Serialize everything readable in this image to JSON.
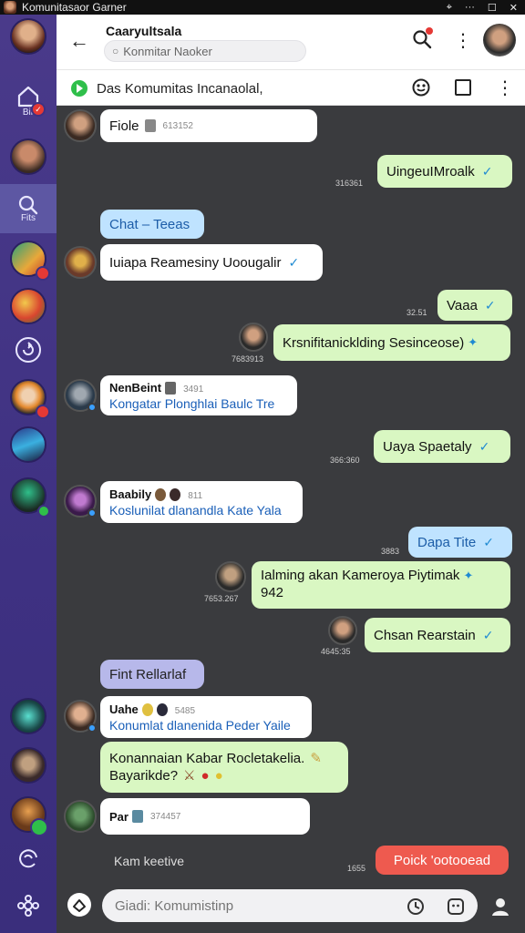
{
  "window": {
    "title": "Komunitasaor Garner",
    "controls": [
      "⌖",
      "···",
      "☐",
      "✕"
    ]
  },
  "rail": {
    "items": [
      {
        "type": "avatar",
        "name": "profile",
        "color": "#c98160"
      },
      {
        "type": "icon",
        "icon": "home-icon",
        "label": "Bir",
        "badge": "red"
      },
      {
        "type": "avatar",
        "name": "friend-1",
        "color": "#9a6a4a"
      },
      {
        "type": "icon",
        "icon": "search-icon",
        "label": "Fits",
        "active": true
      },
      {
        "type": "avatar",
        "name": "game-1",
        "color": "#2f9a8a",
        "badge": "red"
      },
      {
        "type": "avatar",
        "name": "game-2",
        "color": "#d9462f"
      },
      {
        "type": "icon",
        "icon": "refresh-icon",
        "label": ""
      },
      {
        "type": "avatar",
        "name": "game-3",
        "color": "#e58a2f",
        "badge": "red"
      },
      {
        "type": "avatar",
        "name": "game-4",
        "color": "#3a8ac9"
      },
      {
        "type": "avatar",
        "name": "game-5",
        "color": "#1f7a5a",
        "badge": "green"
      },
      {
        "type": "avatar",
        "name": "game-6",
        "color": "#2a9aa0"
      },
      {
        "type": "avatar",
        "name": "game-7",
        "color": "#5a4a3a"
      },
      {
        "type": "avatar",
        "name": "game-8",
        "color": "#8a5a2a",
        "badge": "green"
      },
      {
        "type": "icon",
        "icon": "mention-icon",
        "label": ""
      },
      {
        "type": "icon",
        "icon": "settings-icon",
        "label": ""
      }
    ]
  },
  "header": {
    "title": "Caaryultsala",
    "search_placeholder": "Konmitar Naoker",
    "search_icon": "search-icon",
    "menu_icon": "kebab-icon"
  },
  "community": {
    "title": "Das Komumitas Incanaolal,",
    "icons": [
      "emoji-icon",
      "square-icon",
      "kebab-icon"
    ]
  },
  "messages": [
    {
      "dir": "in",
      "avatar": true,
      "text": "Fiole",
      "meta": "613152"
    },
    {
      "dir": "out",
      "text": "UingeuIMroalk",
      "ts": "316361",
      "tick": true
    },
    {
      "dir": "pill-blue",
      "text": "Chat – Teeas"
    },
    {
      "dir": "in",
      "avatar": true,
      "text": "Iuiapa Reamesiny Uoougalir",
      "tick": true
    },
    {
      "dir": "out",
      "text": "Vaaa",
      "ts": "32.51",
      "tick": true
    },
    {
      "dir": "out-avatar",
      "text": "Krsnifitanicklding Sesinceose)",
      "ts": "7683913",
      "spark": true
    },
    {
      "dir": "in-named",
      "avatar": true,
      "name": "NenBeint",
      "meta": "3491",
      "text": "Kongatar Plonghlai Baulc Tre"
    },
    {
      "dir": "out",
      "text": "Uaya Spaetaly",
      "ts": "366:360",
      "tick": true
    },
    {
      "dir": "in-named",
      "avatar": true,
      "name": "Baabily",
      "meta": "811",
      "text": "Koslunilat dlanandla Kate Yala"
    },
    {
      "dir": "out-blue",
      "text": "Dapa Tite",
      "ts": "3883",
      "tick": true
    },
    {
      "dir": "out-avatar",
      "text": "Ialming akan Kameroya Piytimak",
      "text2": "942",
      "ts": "7653.267",
      "spark": true
    },
    {
      "dir": "out-avatar",
      "text": "Chsan Rearstain",
      "ts": "4645:35",
      "tick": true
    },
    {
      "dir": "pill-purple",
      "text": "Fint Rellarlaf"
    },
    {
      "dir": "in-named",
      "avatar": true,
      "name": "Uahe",
      "meta": "5485",
      "text": "Konumlat dlanenida Peder Yaile"
    },
    {
      "dir": "in-green",
      "text": "Konannaian Kabar Rocletakelia.",
      "text2": "Bayarikde?"
    },
    {
      "dir": "in",
      "avatar": true,
      "text": "Par",
      "meta": "374457"
    }
  ],
  "footer": {
    "typing": "Kam keetive",
    "unread_ts": "1655",
    "unread_label": "Poick 'ootooead",
    "composer_placeholder": "Giadi: Komumistinp"
  },
  "colors": {
    "rail": "#3e3182",
    "incoming": "#ffffff",
    "outgoing": "#d9f7c2",
    "accent_blue": "#1f8ad2",
    "alert_red": "#ee5a4f"
  }
}
